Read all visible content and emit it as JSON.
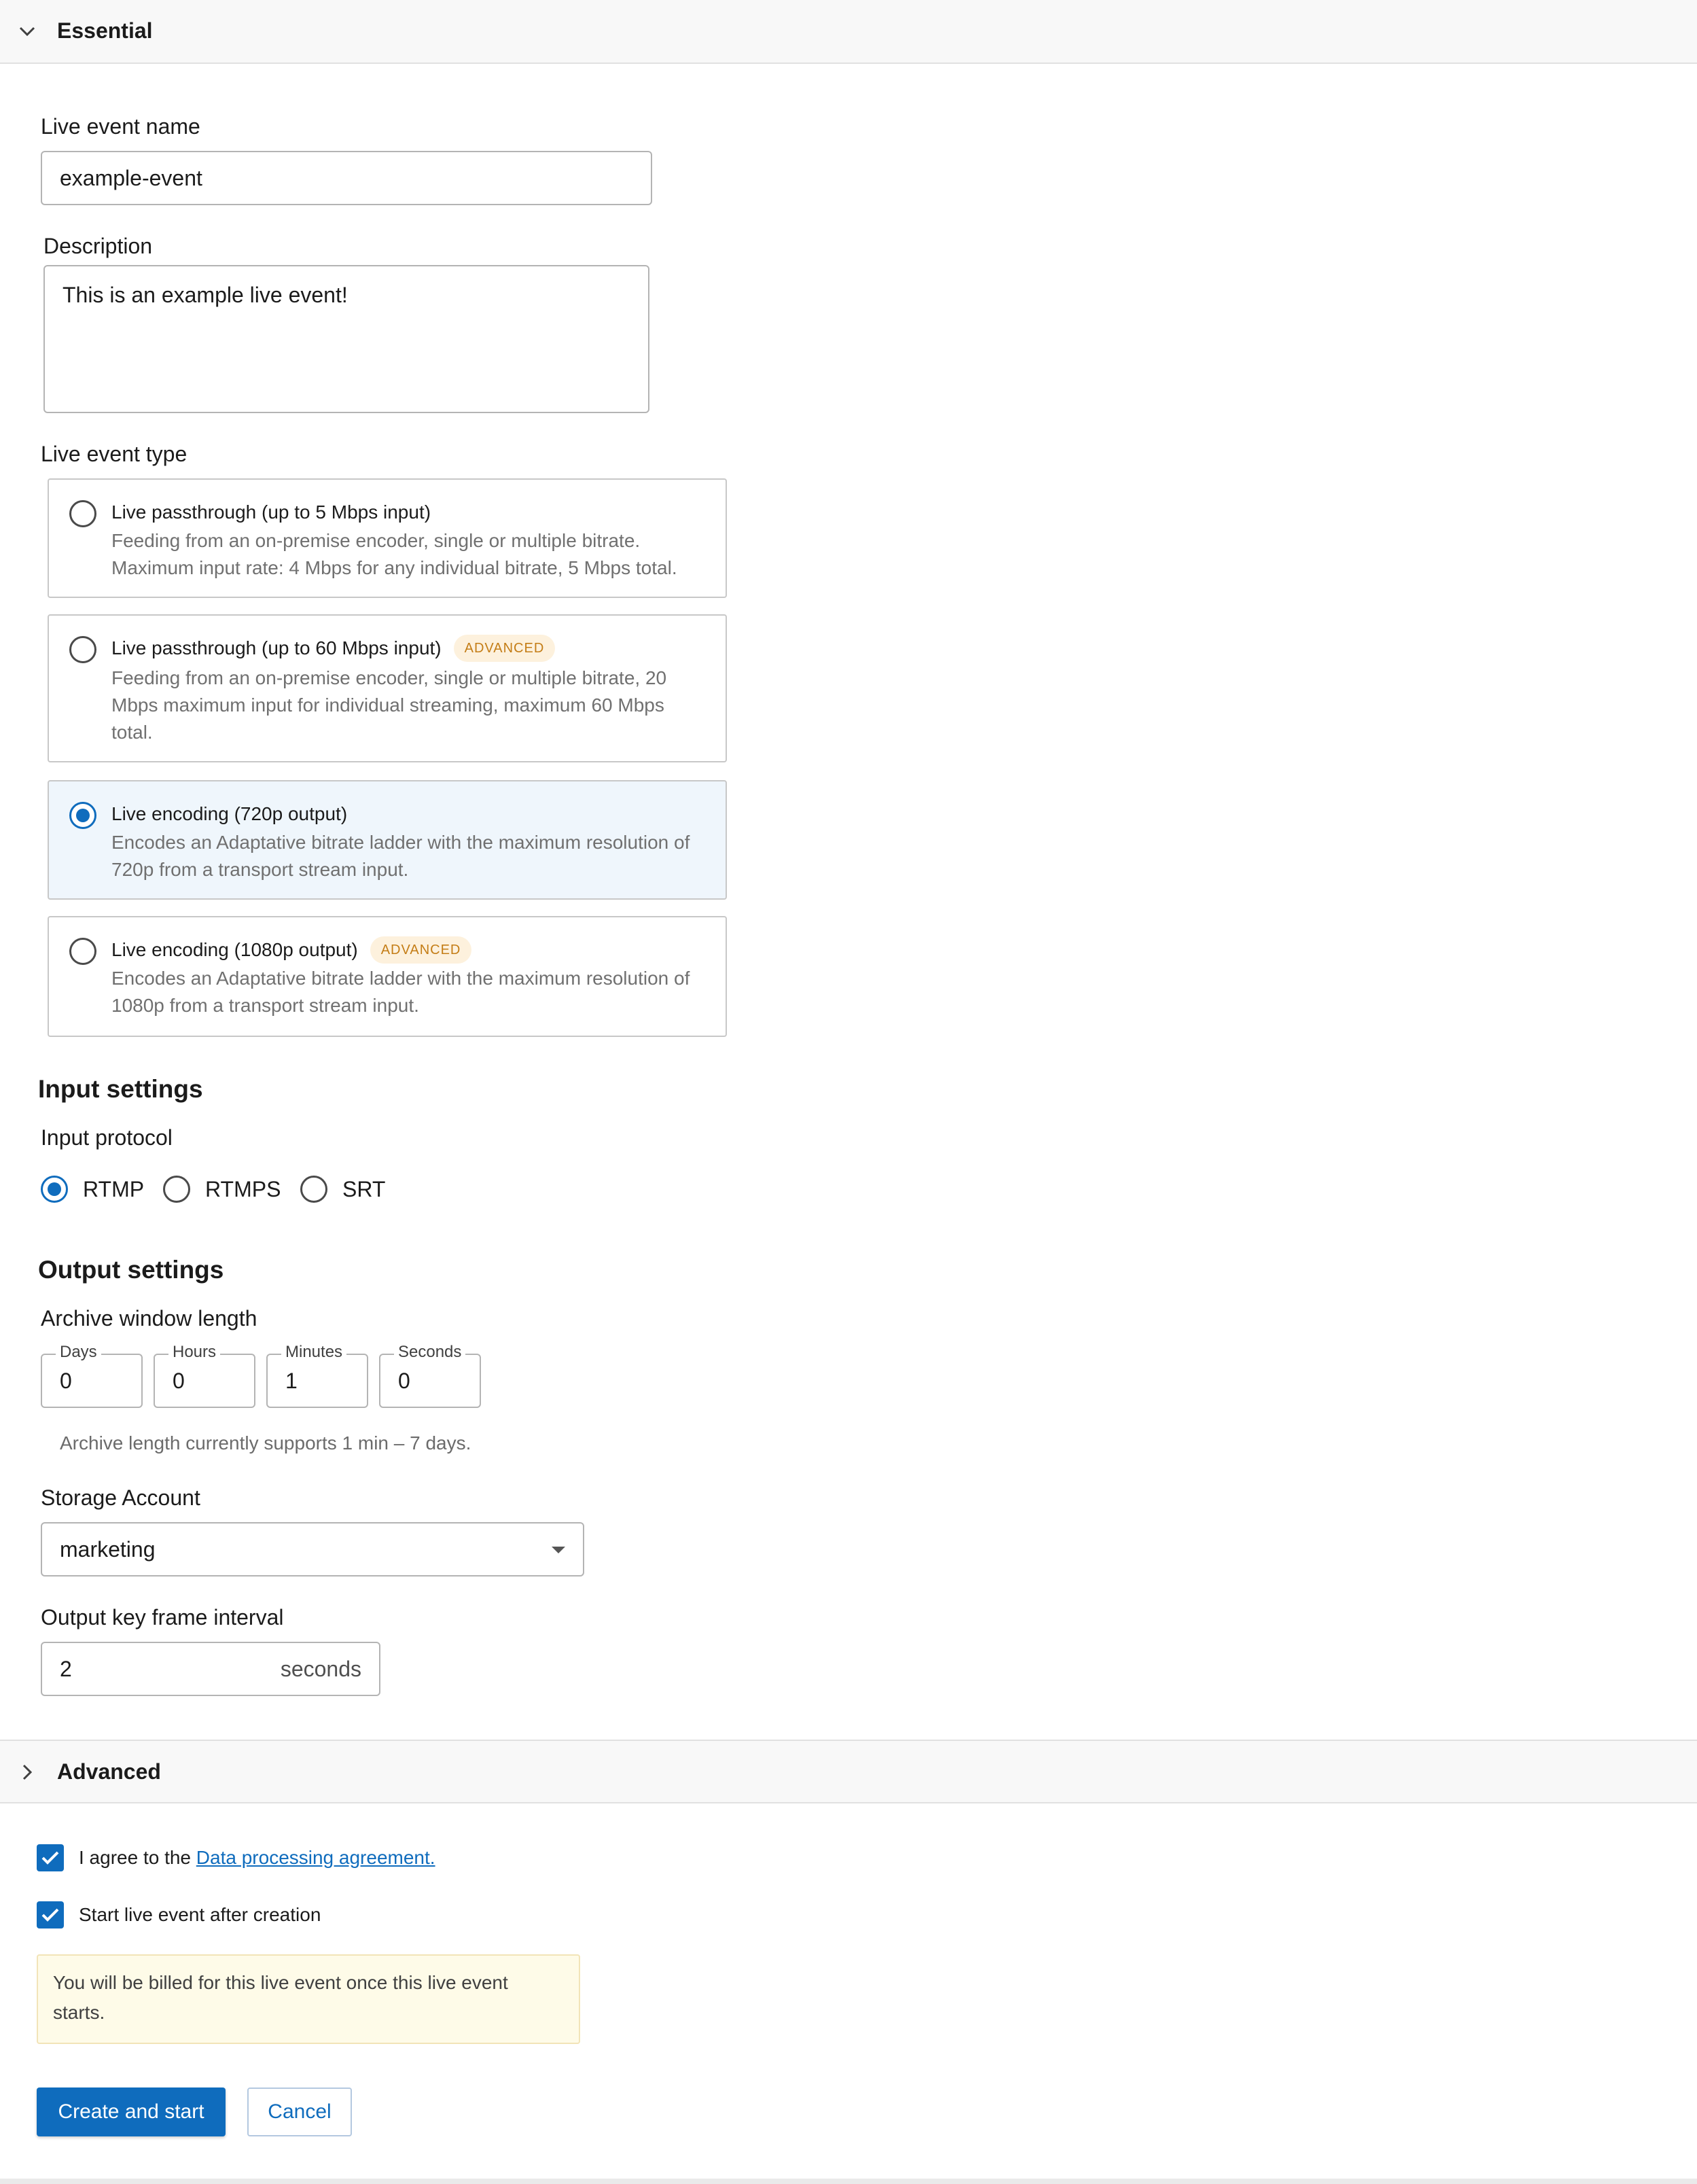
{
  "essential": {
    "title": "Essential"
  },
  "name_field": {
    "label": "Live event name",
    "value": "example-event"
  },
  "description_field": {
    "label": "Description",
    "value": "This is an example live event!"
  },
  "event_type": {
    "label": "Live event type",
    "options": [
      {
        "title": "Live passthrough (up to 5 Mbps input)",
        "badge": "",
        "description": "Feeding from an on-premise encoder, single or multiple bitrate. Maximum input rate: 4 Mbps for any individual bitrate, 5 Mbps total.",
        "selected": false
      },
      {
        "title": "Live passthrough (up to 60 Mbps input)",
        "badge": "ADVANCED",
        "description": "Feeding from an on-premise encoder, single or multiple bitrate, 20 Mbps maximum input for individual streaming, maximum 60 Mbps total.",
        "selected": false
      },
      {
        "title": "Live encoding (720p output)",
        "badge": "",
        "description": "Encodes an Adaptative bitrate ladder with the maximum resolution of 720p from a transport stream input.",
        "selected": true
      },
      {
        "title": "Live encoding (1080p output)",
        "badge": "ADVANCED",
        "description": "Encodes an Adaptative bitrate ladder with the maximum resolution of 1080p from a transport stream input.",
        "selected": false
      }
    ]
  },
  "input_settings": {
    "heading": "Input settings",
    "protocol_label": "Input protocol",
    "protocols": [
      {
        "label": "RTMP",
        "selected": true
      },
      {
        "label": "RTMPS",
        "selected": false
      },
      {
        "label": "SRT",
        "selected": false
      }
    ]
  },
  "output_settings": {
    "heading": "Output settings",
    "archive_label": "Archive window length",
    "archive": [
      {
        "caption": "Days",
        "value": "0"
      },
      {
        "caption": "Hours",
        "value": "0"
      },
      {
        "caption": "Minutes",
        "value": "1"
      },
      {
        "caption": "Seconds",
        "value": "0"
      }
    ],
    "archive_helper": "Archive length currently supports 1 min – 7 days.",
    "storage_label": "Storage Account",
    "storage_value": "marketing",
    "keyframe_label": "Output key frame interval",
    "keyframe_value": "2",
    "keyframe_unit": "seconds"
  },
  "advanced": {
    "title": "Advanced"
  },
  "agreement": {
    "prefix": "I agree to the ",
    "link": "Data processing agreement.",
    "checked": true
  },
  "start_after": {
    "label": "Start live event after creation",
    "checked": true
  },
  "billing_notice": "You will be billed for this live event once this live event starts.",
  "actions": {
    "primary": "Create and start",
    "cancel": "Cancel"
  },
  "colors": {
    "accent": "#0f6cbd",
    "badge_text": "#c47d16",
    "badge_bg": "#fdf1dd",
    "selected_bg": "#eff6fc",
    "warning_bg": "#fefbe8"
  },
  "icons": {
    "collapse": "chevron-down-icon",
    "expand": "chevron-right-icon",
    "dropdown": "caret-down-icon",
    "check": "check-icon"
  }
}
